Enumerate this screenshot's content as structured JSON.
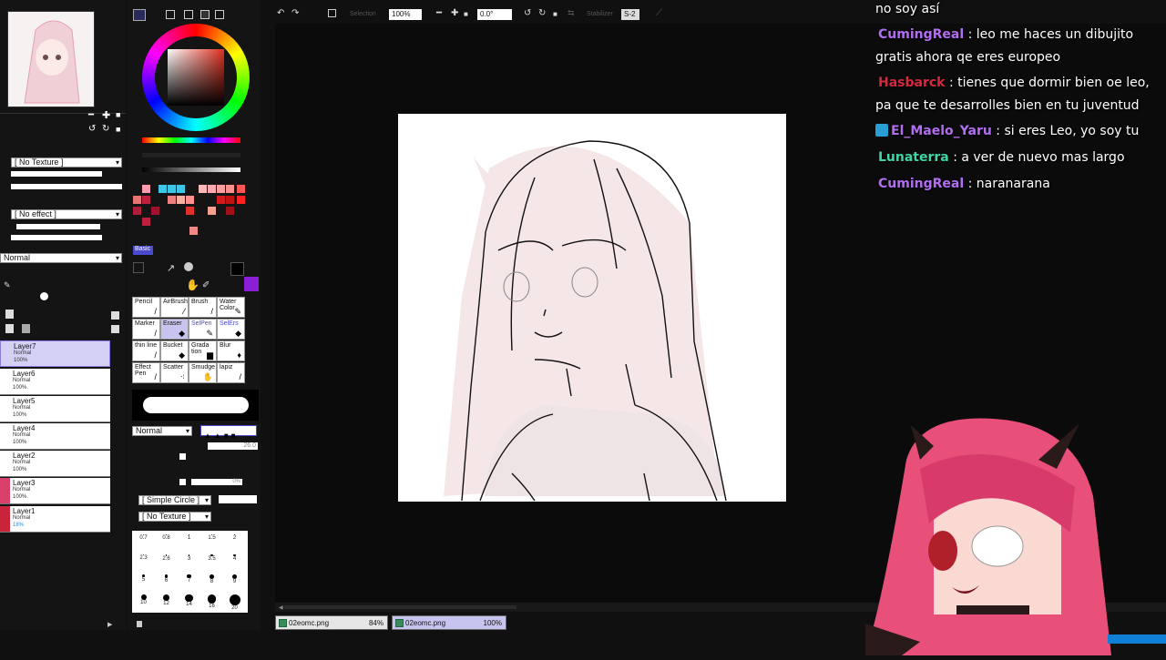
{
  "toolbar": {
    "zoom": "100%",
    "rotation": "0.0°",
    "selection_label": "Selection",
    "stabilizer_label": "Stabilizer",
    "stabilizer_value": "S-2"
  },
  "layers_panel": {
    "texture_select": "[ No Texture ]",
    "effect_select": "[ No effect ]",
    "blend_mode": "Normal",
    "opacity_value": "100%",
    "layers": [
      {
        "name": "Layer7",
        "mode": "Normal",
        "opacity": "100%",
        "selected": true
      },
      {
        "name": "Layer6",
        "mode": "Normal",
        "opacity": "100%",
        "selected": false
      },
      {
        "name": "Layer5",
        "mode": "Normal",
        "opacity": "100%",
        "selected": false
      },
      {
        "name": "Layer4",
        "mode": "Normal",
        "opacity": "100%",
        "selected": false
      },
      {
        "name": "Layer2",
        "mode": "Normal",
        "opacity": "100%",
        "selected": false
      },
      {
        "name": "Layer3",
        "mode": "Normal",
        "opacity": "100%",
        "selected": false
      },
      {
        "name": "Layer1",
        "mode": "Normal",
        "opacity": "18%",
        "selected": false
      }
    ]
  },
  "tool_panel": {
    "palette_tab": "Basic",
    "tools": [
      {
        "label": "Pencil",
        "icon": "pencil-icon"
      },
      {
        "label": "AirBrush",
        "icon": "airbrush-icon"
      },
      {
        "label": "Brush",
        "icon": "brush-icon"
      },
      {
        "label": "Water Color",
        "icon": "watercolor-icon"
      },
      {
        "label": "Marker",
        "icon": "marker-icon"
      },
      {
        "label": "Eraser",
        "icon": "eraser-icon"
      },
      {
        "label": "SelPen",
        "icon": "selpen-icon"
      },
      {
        "label": "SelErs",
        "icon": "selers-icon"
      },
      {
        "label": "thin line",
        "icon": "thin-line-icon"
      },
      {
        "label": "Bucket",
        "icon": "bucket-icon"
      },
      {
        "label": "Grada tion",
        "icon": "gradation-icon"
      },
      {
        "label": "Blur",
        "icon": "blur-icon"
      },
      {
        "label": "Effect Pen",
        "icon": "effect-pen-icon"
      },
      {
        "label": "Scatter",
        "icon": "scatter-icon"
      },
      {
        "label": "Smudge",
        "icon": "smudge-icon"
      },
      {
        "label": "lapiz",
        "icon": "lapiz-icon"
      }
    ],
    "brush_mode": "Normal",
    "brush_size_value": "26.0",
    "min_size_value": "0%",
    "shape_select": "[ Simple Circle ]",
    "texture_select": "[ No Texture ]",
    "brush_sizes": [
      "0.7",
      "0.8",
      "1",
      "1.5",
      "2",
      "2.3",
      "2.6",
      "3",
      "3.5",
      "4",
      "5",
      "6",
      "7",
      "8",
      "9",
      "10",
      "12",
      "14",
      "16",
      "20"
    ],
    "accent_color": "#8b1fd6"
  },
  "file_tabs": [
    {
      "name": "02eomc.png",
      "zoom": "84%",
      "active": false
    },
    {
      "name": "02eomc.png",
      "zoom": "100%",
      "active": true
    }
  ],
  "chat": [
    {
      "user": "",
      "color": "#ffffff",
      "message": "no soy así",
      "badge": false
    },
    {
      "user": "CumingReal",
      "color": "#b26df2",
      "message": ": leo me haces un dibujito gratis ahora qe eres europeo",
      "badge": false
    },
    {
      "user": "Hasbarck",
      "color": "#d32a40",
      "message": ": tienes que dormir bien oe leo, pa que te desarrolles bien en tu juventud",
      "badge": false
    },
    {
      "user": "El_Maelo_Yaru",
      "color": "#b26df2",
      "message": ": si eres Leo, yo soy tu",
      "badge": true
    },
    {
      "user": "Lunaterra",
      "color": "#3fd5a8",
      "message": ": a ver de nuevo mas largo",
      "badge": false
    },
    {
      "user": "CumingReal",
      "color": "#b26df2",
      "message": ": naranarana",
      "badge": false
    }
  ]
}
